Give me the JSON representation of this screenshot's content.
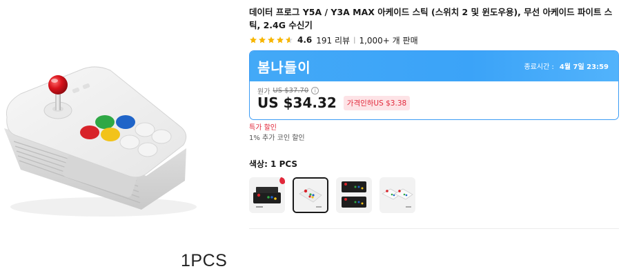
{
  "product": {
    "title": "데이터 프로그 Y5A / Y3A MAX 아케이드 스틱 (스위치 2 및 윈도우용), 무선 아케이드 파이트 스틱, 2.4G 수신기",
    "image_caption": "1PCS",
    "rating": "4.6",
    "stars_filled": 4.6,
    "review_count": "191 리뷰",
    "separator": "|",
    "sold": "1,000+ 개 판매"
  },
  "promo": {
    "name": "봄나들이",
    "end_label": "종료시간 :",
    "end_time": "4월 7일 23:59",
    "original_label": "원가",
    "original_price": "US $37.70",
    "info_icon": "ⓘ",
    "price": "US $34.32",
    "discount_badge": "가격인하US $3.38"
  },
  "offers": {
    "special": "특가 할인",
    "coin": "1% 추가 코인 할인"
  },
  "variants": {
    "label": "색상: 1 PCS",
    "options": [
      "black-stick-pair",
      "1pcs-white",
      "black-2pcs",
      "white-2pcs"
    ],
    "selected_index": 1
  },
  "colors": {
    "accent": "#3ba3f8",
    "star": "#f7b500",
    "discount": "#e1293b",
    "badge_bg": "#fde3e6"
  }
}
